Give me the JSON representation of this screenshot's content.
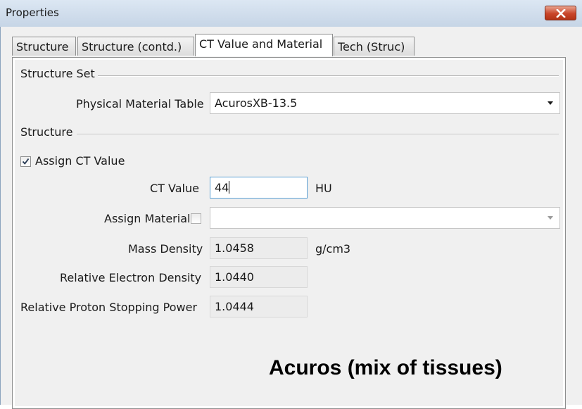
{
  "window": {
    "title": "Properties"
  },
  "tabs": [
    {
      "label": "Structure",
      "active": false
    },
    {
      "label": "Structure (contd.)",
      "active": false
    },
    {
      "label": "CT Value and Material",
      "active": true
    },
    {
      "label": "Tech (Struc)",
      "active": false
    }
  ],
  "structure_set": {
    "group_label": "Structure Set",
    "physical_material_table_label": "Physical Material Table",
    "physical_material_table_value": "AcurosXB-13.5"
  },
  "structure": {
    "group_label": "Structure",
    "assign_ct_value_label": "Assign CT Value",
    "assign_ct_value_checked": true,
    "ct_value_label": "CT Value",
    "ct_value": "44",
    "ct_value_unit": "HU",
    "assign_material_label": "Assign Material",
    "assign_material_checked": false,
    "assign_material_value": "",
    "mass_density_label": "Mass Density",
    "mass_density_value": "1.0458",
    "mass_density_unit": "g/cm3",
    "relative_electron_density_label": "Relative Electron Density",
    "relative_electron_density_value": "1.0440",
    "relative_proton_stopping_power_label": "Relative Proton Stopping Power",
    "relative_proton_stopping_power_value": "1.0444"
  },
  "annotation": {
    "text": "Acuros (mix of tissues)"
  },
  "colors": {
    "titlebar": "#cfdbe8",
    "close_button": "#c9452a",
    "dialog_background": "#f0f0f0",
    "focus_border": "#5a9fd4"
  },
  "icons": {
    "close": "close-icon",
    "dropdown": "chevron-down-icon",
    "check": "check-icon"
  }
}
